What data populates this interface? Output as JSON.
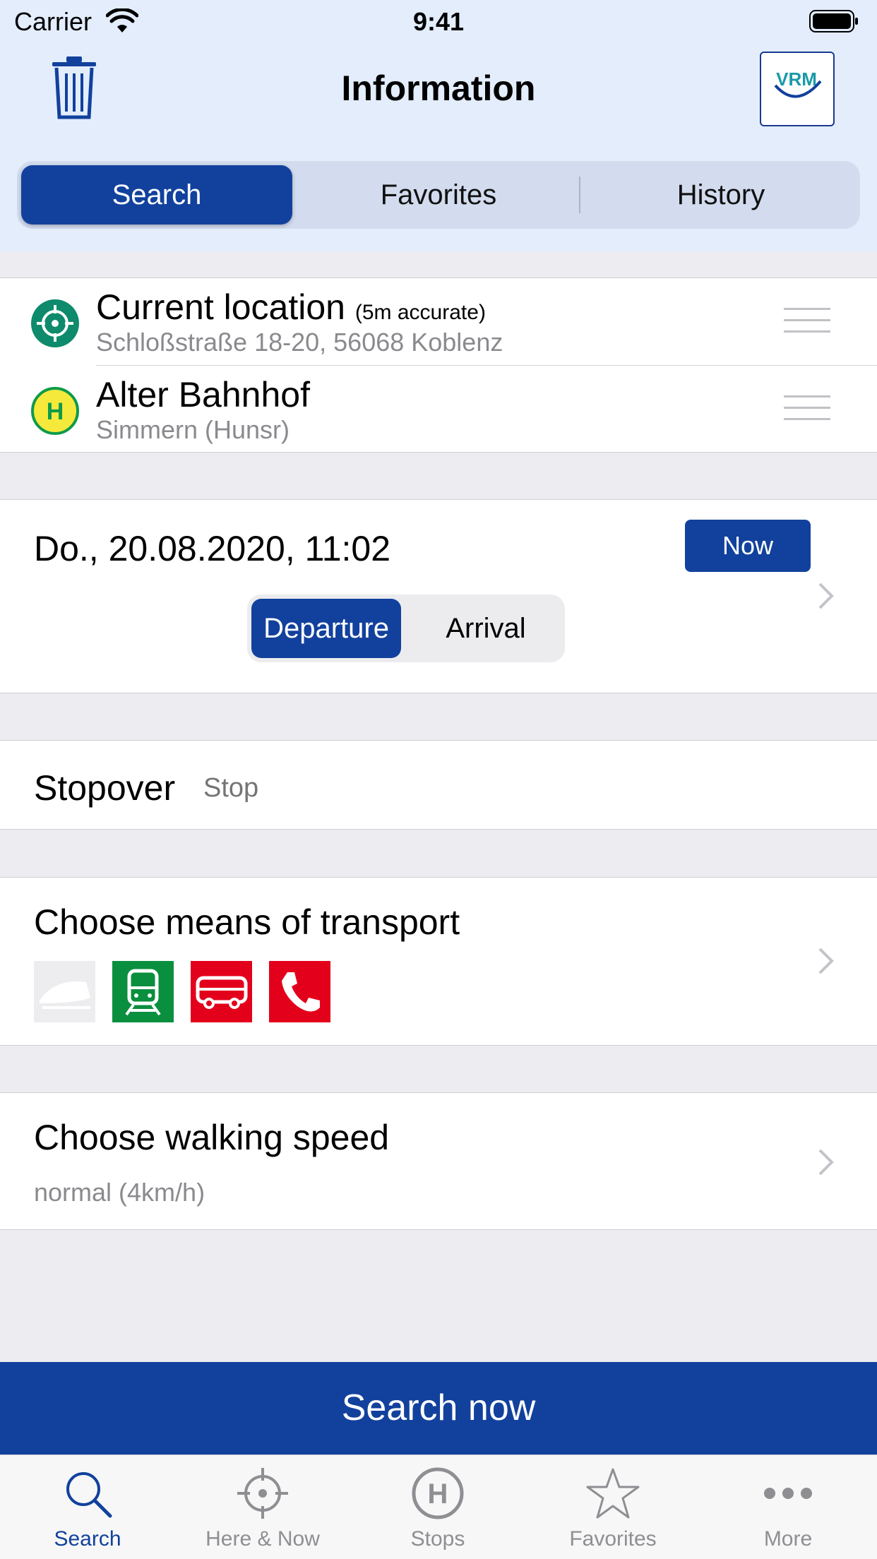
{
  "status_bar": {
    "carrier": "Carrier",
    "time": "9:41"
  },
  "nav": {
    "title": "Information",
    "logo_text": "VRM"
  },
  "segments": [
    {
      "label": "Search",
      "active": true
    },
    {
      "label": "Favorites",
      "active": false
    },
    {
      "label": "History",
      "active": false
    }
  ],
  "locations": [
    {
      "title": "Current location",
      "note": "(5m accurate)",
      "subtitle": "Schloßstraße 18-20, 56068 Koblenz",
      "icon": "crosshair-icon"
    },
    {
      "title": "Alter Bahnhof",
      "note": "",
      "subtitle": "Simmern (Hunsr)",
      "icon": "bus-stop-icon"
    }
  ],
  "datetime": {
    "value": "Do., 20.08.2020, 11:02",
    "now_label": "Now",
    "departure_label": "Departure",
    "arrival_label": "Arrival"
  },
  "stopover": {
    "label": "Stopover",
    "placeholder": "Stop"
  },
  "transport": {
    "title": "Choose means of transport",
    "icons": [
      "high-speed-train-icon",
      "regional-train-icon",
      "bus-icon",
      "on-demand-phone-icon"
    ]
  },
  "walking": {
    "title": "Choose walking speed",
    "value": "normal (4km/h)"
  },
  "search_button": "Search now",
  "tabs": [
    {
      "label": "Search",
      "icon": "search-icon",
      "active": true
    },
    {
      "label": "Here & Now",
      "icon": "crosshair-icon",
      "active": false
    },
    {
      "label": "Stops",
      "icon": "stop-h-icon",
      "active": false
    },
    {
      "label": "Favorites",
      "icon": "star-icon",
      "active": false
    },
    {
      "label": "More",
      "icon": "more-icon",
      "active": false
    }
  ],
  "colors": {
    "primary": "#12419d",
    "header_bg": "#e3edfc",
    "location_green": "#0e8a6c",
    "stop_yellow": "#f5e93b",
    "train_green": "#0a8f3e",
    "bus_red": "#e3001b"
  }
}
